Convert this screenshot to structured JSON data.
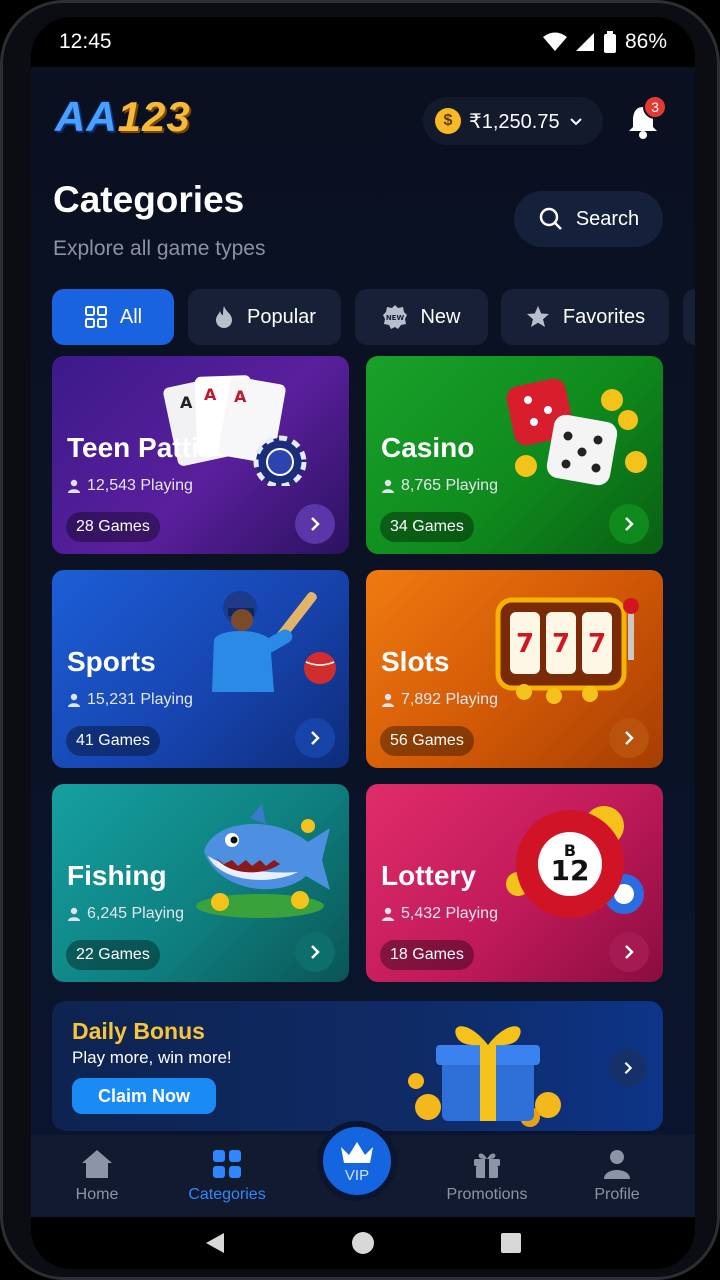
{
  "status_bar": {
    "time": "12:45",
    "battery": "86%"
  },
  "header": {
    "logo_letters": "AA",
    "logo_number": "123",
    "balance": "₹1,250.75",
    "notification_count": "3"
  },
  "page": {
    "title": "Categories",
    "subtitle": "Explore all game types",
    "search_label": "Search"
  },
  "tabs": [
    {
      "label": "All",
      "icon": "grid-icon",
      "active": true
    },
    {
      "label": "Popular",
      "icon": "flame-icon",
      "active": false
    },
    {
      "label": "New",
      "icon": "new-badge-icon",
      "active": false
    },
    {
      "label": "Favorites",
      "icon": "star-icon",
      "active": false
    }
  ],
  "categories": [
    {
      "title": "Teen Patti",
      "players": "12,543 Playing",
      "games": "28 Games",
      "arrow_color": "#5b36a8"
    },
    {
      "title": "Casino",
      "players": "8,765 Playing",
      "games": "34 Games",
      "arrow_color": "#0f8a1d"
    },
    {
      "title": "Sports",
      "players": "15,231 Playing",
      "games": "41 Games",
      "arrow_color": "#1744a8"
    },
    {
      "title": "Slots",
      "players": "7,892 Playing",
      "games": "56 Games",
      "arrow_color": "#b8520c"
    },
    {
      "title": "Fishing",
      "players": "6,245 Playing",
      "games": "22 Games",
      "arrow_color": "#0d6e6c"
    },
    {
      "title": "Lottery",
      "players": "5,432 Playing",
      "games": "18 Games",
      "arrow_color": "#a51a52"
    }
  ],
  "bonus": {
    "title": "Daily Bonus",
    "subtitle": "Play more, win more!",
    "button": "Claim Now"
  },
  "bottom_nav": [
    {
      "label": "Home",
      "icon": "home-icon",
      "active": false
    },
    {
      "label": "Categories",
      "icon": "grid-icon",
      "active": true
    },
    {
      "label": "VIP",
      "icon": "crown-icon",
      "active": false
    },
    {
      "label": "Promotions",
      "icon": "gift-icon",
      "active": false
    },
    {
      "label": "Profile",
      "icon": "user-icon",
      "active": false
    }
  ],
  "colors": {
    "accent": "#1a63e0",
    "background": "#0a1020",
    "gold": "#f7c43a"
  }
}
